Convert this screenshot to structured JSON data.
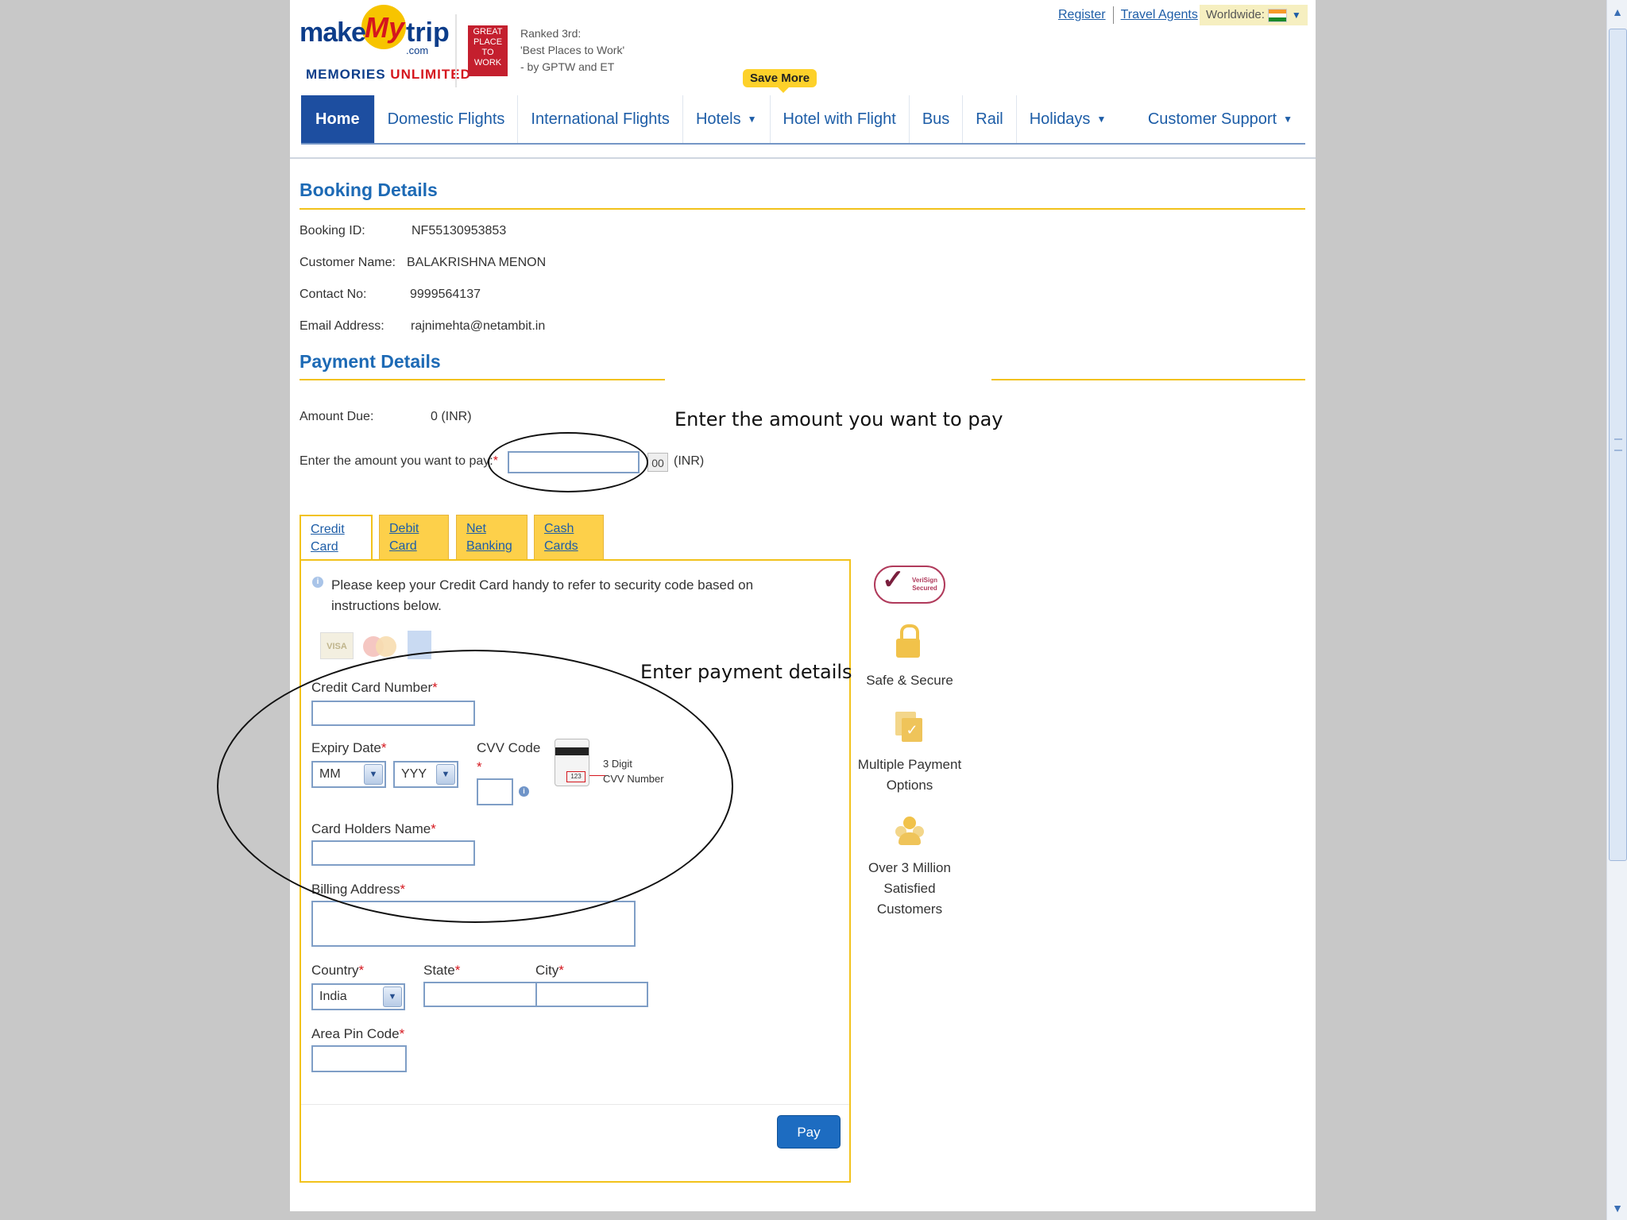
{
  "header": {
    "logo": {
      "make": "make",
      "my": "My",
      "trip": "trip",
      "dotcom": ".com",
      "tagline_1": "MEMORIES",
      "tagline_2": "UNLIMITED"
    },
    "gptw_badge": "GREAT PLACE TO WORK",
    "gptw_text": [
      "Ranked 3rd:",
      "'Best Places to Work'",
      "- by GPTW and ET"
    ],
    "register": "Register",
    "travel_agents": "Travel Agents",
    "worldwide": "Worldwide:",
    "save_more": "Save More"
  },
  "nav": {
    "items": [
      "Home",
      "Domestic Flights",
      "International Flights",
      "Hotels",
      "Hotel with Flight",
      "Bus",
      "Rail",
      "Holidays"
    ],
    "customer_support": "Customer Support"
  },
  "booking": {
    "title": "Booking Details",
    "id_label": "Booking ID:",
    "id_value": "NF55130953853",
    "name_label": "Customer Name:",
    "name_value": "BALAKRISHNA MENON",
    "contact_label": "Contact No:",
    "contact_value": "9999564137",
    "email_label": "Email Address:",
    "email_value": "rajnimehta@netambit.in"
  },
  "payment": {
    "title": "Payment Details",
    "amount_due_label": "Amount Due:",
    "amount_due_value": "0 (INR)",
    "enter_amount_label": "Enter the amount you want to pay:",
    "paise": "00",
    "currency": "(INR)",
    "tabs": [
      [
        "Credit",
        "Card"
      ],
      [
        "Debit",
        "Card"
      ],
      [
        "Net",
        "Banking"
      ],
      [
        "Cash",
        "Cards"
      ]
    ],
    "info": [
      "Please keep your Credit Card handy to refer to security code based on",
      "instructions below."
    ],
    "card_brands": [
      "VISA",
      "MasterCard",
      "AMEX"
    ],
    "cc_number_label": "Credit Card Number",
    "expiry_label": "Expiry Date",
    "month_value": "MM",
    "year_value": "YYY",
    "cvv_label": "CVV Code",
    "cvv_hint": [
      "3 Digit",
      "CVV Number"
    ],
    "cvv_sample": "123",
    "holder_label": "Card Holders Name",
    "billing_label": "Billing Address",
    "country_label": "Country",
    "country_value": "India",
    "state_label": "State",
    "city_label": "City",
    "pin_label": "Area Pin Code",
    "pay_button": "Pay"
  },
  "sidebar": {
    "verisign": "VeriSign Secured",
    "safe": "Safe & Secure",
    "multiple": [
      "Multiple Payment",
      "Options"
    ],
    "customers": [
      "Over 3 Million",
      "Satisfied",
      "Customers"
    ]
  },
  "annotations": {
    "amount": "Enter the amount you want to pay",
    "details": "Enter payment details"
  }
}
